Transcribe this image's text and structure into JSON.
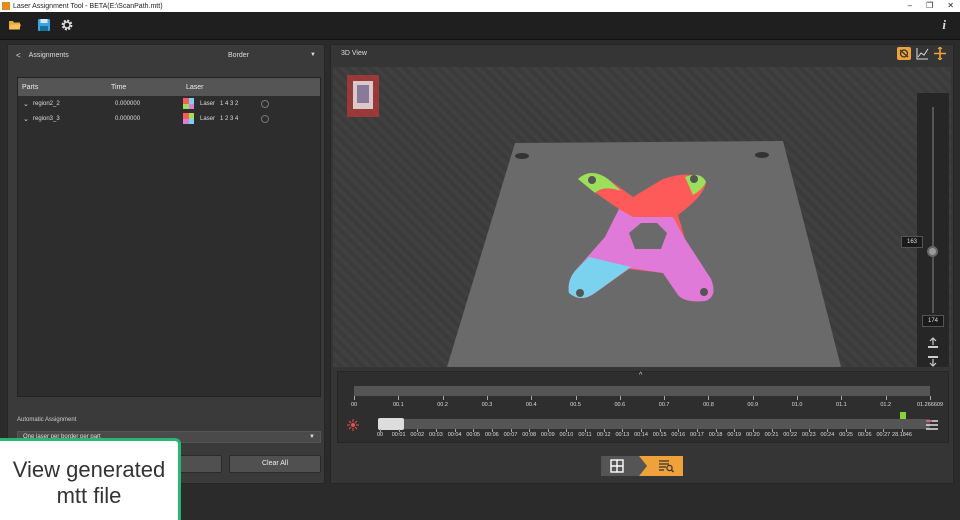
{
  "window": {
    "title": "Laser Assignment Tool - BETA(E:\\ScanPath.mtt)",
    "controls": [
      "–",
      "❐",
      "✕"
    ]
  },
  "toolbar": {
    "icons": [
      "folder-open-icon",
      "save-icon",
      "gear-icon"
    ],
    "info_label": "i"
  },
  "assignments": {
    "back_label": "<",
    "title": "Assignments",
    "mode": "Border",
    "table": {
      "headers": [
        "Parts",
        "Time",
        "Laser"
      ],
      "rows": [
        {
          "part": "region2_2",
          "time": "0.000000",
          "laser_label": "Laser",
          "laser_order": "1 4 3 2"
        },
        {
          "part": "region3_3",
          "time": "0.000000",
          "laser_label": "Laser",
          "laser_order": "1 2 3 4"
        }
      ]
    },
    "automatic_label": "Automatic Assignment",
    "automatic_option": "One laser per border per part",
    "clear_label": "Clear All"
  },
  "view": {
    "title": "3D View",
    "height_value": "163",
    "max_value": "174"
  },
  "timeline": {
    "top_ticks": [
      "00",
      "00.1",
      "00.2",
      "00.3",
      "00.4",
      "00.5",
      "00.6",
      "00.7",
      "00.8",
      "00.9",
      "01.0",
      "01.1",
      "01.2",
      "01.266609"
    ],
    "bottom_ticks": [
      "00",
      "00:01",
      "00:02",
      "00:03",
      "00:04",
      "00:05",
      "00:06",
      "00:07",
      "00:08",
      "00:09",
      "00:10",
      "00:11",
      "00:12",
      "00:13",
      "00:14",
      "00:15",
      "00:16",
      "00:17",
      "00:18",
      "00:19",
      "00:20",
      "00:21",
      "00:22",
      "00:23",
      "00:24",
      "00:25",
      "00:26",
      "00:27",
      "28.1846"
    ],
    "expand_label": "^"
  },
  "overlay": {
    "line1": "View generated",
    "line2": "mtt file"
  },
  "colors": {
    "accent": "#f0a23a",
    "laser1": "#ff5a5a",
    "laser2": "#9be05a",
    "laser3": "#e07ad8",
    "laser4": "#7ad2ef"
  }
}
